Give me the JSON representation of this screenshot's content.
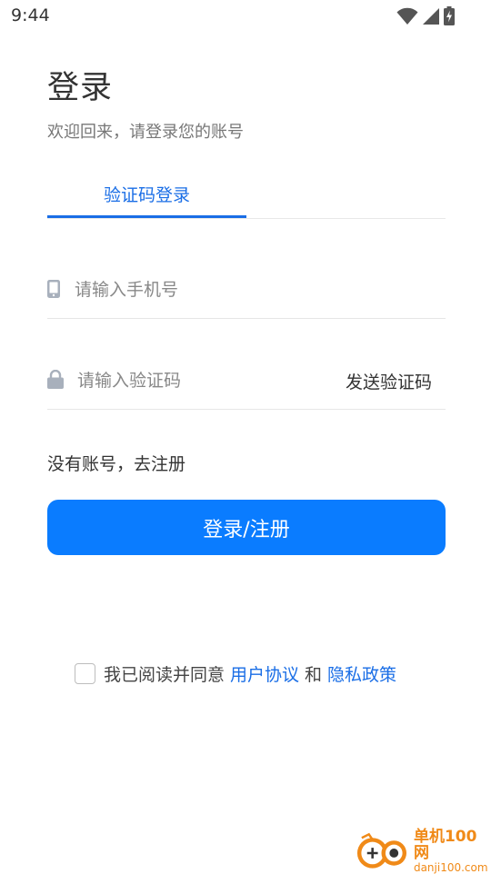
{
  "status_bar": {
    "time": "9:44"
  },
  "header": {
    "title": "登录",
    "subtitle": "欢迎回来，请登录您的账号"
  },
  "tabs": [
    {
      "label": "验证码登录",
      "active": true
    }
  ],
  "form": {
    "phone_placeholder": "请输入手机号",
    "code_placeholder": "请输入验证码",
    "send_code_label": "发送验证码"
  },
  "register_link": "没有账号，去注册",
  "login_button": "登录/注册",
  "agreement": {
    "prefix": "我已阅读并同意",
    "user_agreement": "用户协议",
    "conjunction": "和",
    "privacy_policy": "隐私政策",
    "checked": false
  },
  "watermark": {
    "brand": "单机100网",
    "domain": "danji100.com"
  },
  "colors": {
    "accent": "#1a6ee6",
    "button": "#0a7cff",
    "watermark": "#f08a18"
  },
  "icons": [
    "wifi-icon",
    "signal-icon",
    "battery-charging-icon",
    "phone-icon",
    "lock-icon"
  ]
}
